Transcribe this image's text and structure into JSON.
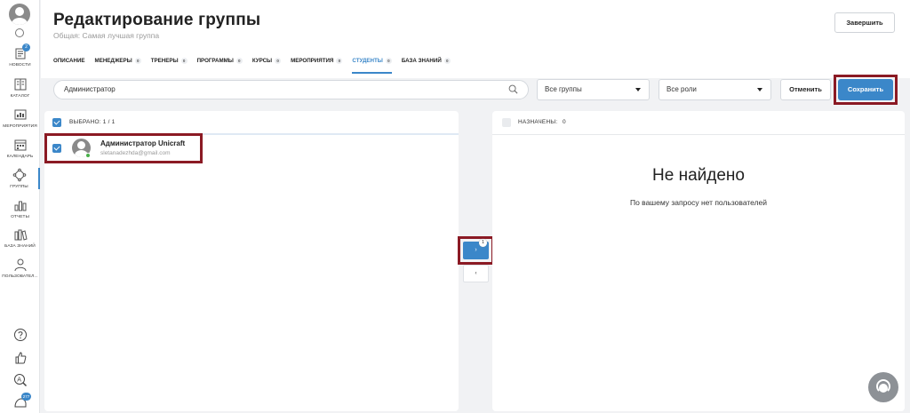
{
  "sidebar": {
    "items": [
      {
        "label": "НОВОСТИ",
        "icon": "news-icon",
        "badge": "2"
      },
      {
        "label": "КАТАЛОГ",
        "icon": "catalog-icon"
      },
      {
        "label": "МЕРОПРИЯТИЯ",
        "icon": "events-icon"
      },
      {
        "label": "КАЛЕНДАРЬ",
        "icon": "calendar-icon"
      },
      {
        "label": "ГРУППЫ",
        "icon": "groups-icon",
        "active": true
      },
      {
        "label": "ОТЧЕТЫ",
        "icon": "reports-icon"
      },
      {
        "label": "БАЗА ЗНАНИЙ",
        "icon": "knowledge-base-icon"
      },
      {
        "label": "ПОЛЬЗОВАТЕЛ...",
        "icon": "users-icon"
      }
    ],
    "bottom": [
      {
        "icon": "help-icon"
      },
      {
        "icon": "thumbs-up-icon"
      },
      {
        "icon": "translate-icon"
      },
      {
        "icon": "chat-icon",
        "badge": "277"
      }
    ]
  },
  "header": {
    "title": "Редактирование группы",
    "subtitle": "Общая: Самая лучшая группа",
    "finish_label": "Завершить"
  },
  "tabs": [
    {
      "label": "ОПИСАНИЕ",
      "count": null
    },
    {
      "label": "МЕНЕДЖЕРЫ",
      "count": "0"
    },
    {
      "label": "ТРЕНЕРЫ",
      "count": "0"
    },
    {
      "label": "ПРОГРАММЫ",
      "count": "0"
    },
    {
      "label": "КУРСЫ",
      "count": "0"
    },
    {
      "label": "МЕРОПРИЯТИЯ",
      "count": "0"
    },
    {
      "label": "СТУДЕНТЫ",
      "count": "0",
      "active": true
    },
    {
      "label": "БАЗА ЗНАНИЙ",
      "count": "0"
    }
  ],
  "toolbar": {
    "search_value": "Администратор",
    "groups_select": "Все группы",
    "roles_select": "Все роли",
    "cancel_label": "Отменить",
    "save_label": "Сохранить"
  },
  "left_panel": {
    "header_label": "ВЫБРАНО: 1 / 1",
    "users": [
      {
        "name": "Администратор Unicraft",
        "email": "sletanadezhda@gmail.com",
        "online": true,
        "checked": true
      }
    ]
  },
  "transfer": {
    "move_badge": "1",
    "move_label": "›",
    "back_label": "‹"
  },
  "right_panel": {
    "header_label": "НАЗНАЧЕНЫ:",
    "header_count": "0",
    "empty_title": "Не найдено",
    "empty_text": "По вашему запросу нет пользователей"
  },
  "colors": {
    "accent": "#3b87c9",
    "highlight": "#8b1a24",
    "online": "#49b14a"
  }
}
